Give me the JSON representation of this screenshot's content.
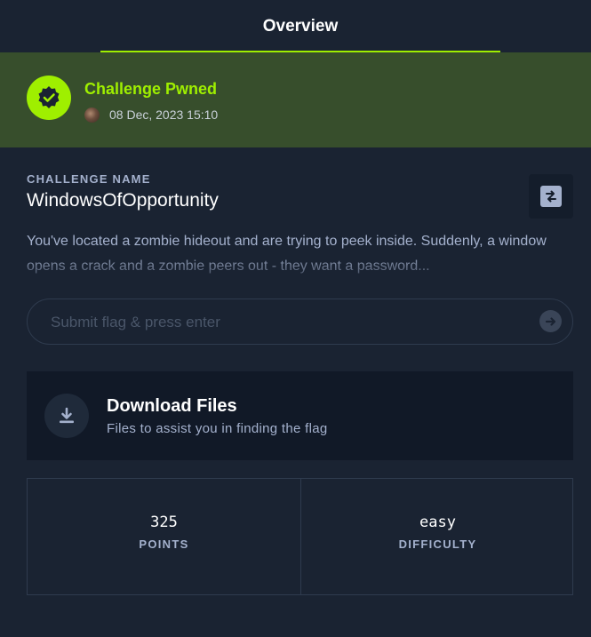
{
  "tabs": {
    "overview_label": "Overview"
  },
  "status": {
    "title": "Challenge Pwned",
    "date": "08 Dec, 2023 15:10",
    "badge_icon": "verified-check-icon",
    "accent_color": "#9fef00"
  },
  "challenge": {
    "name_label": "CHALLENGE NAME",
    "name": "WindowsOfOpportunity",
    "description": "You've located a zombie hideout and are trying to peek inside. Suddenly, a window opens a crack and a zombie peers out - they want a password..."
  },
  "flag": {
    "placeholder": "Submit flag & press enter",
    "value": ""
  },
  "download": {
    "title": "Download Files",
    "subtitle": "Files to assist you in finding the flag",
    "icon": "download-icon"
  },
  "stats": {
    "points_value": "325",
    "points_label": "POINTS",
    "difficulty_value": "easy",
    "difficulty_label": "DIFFICULTY"
  }
}
